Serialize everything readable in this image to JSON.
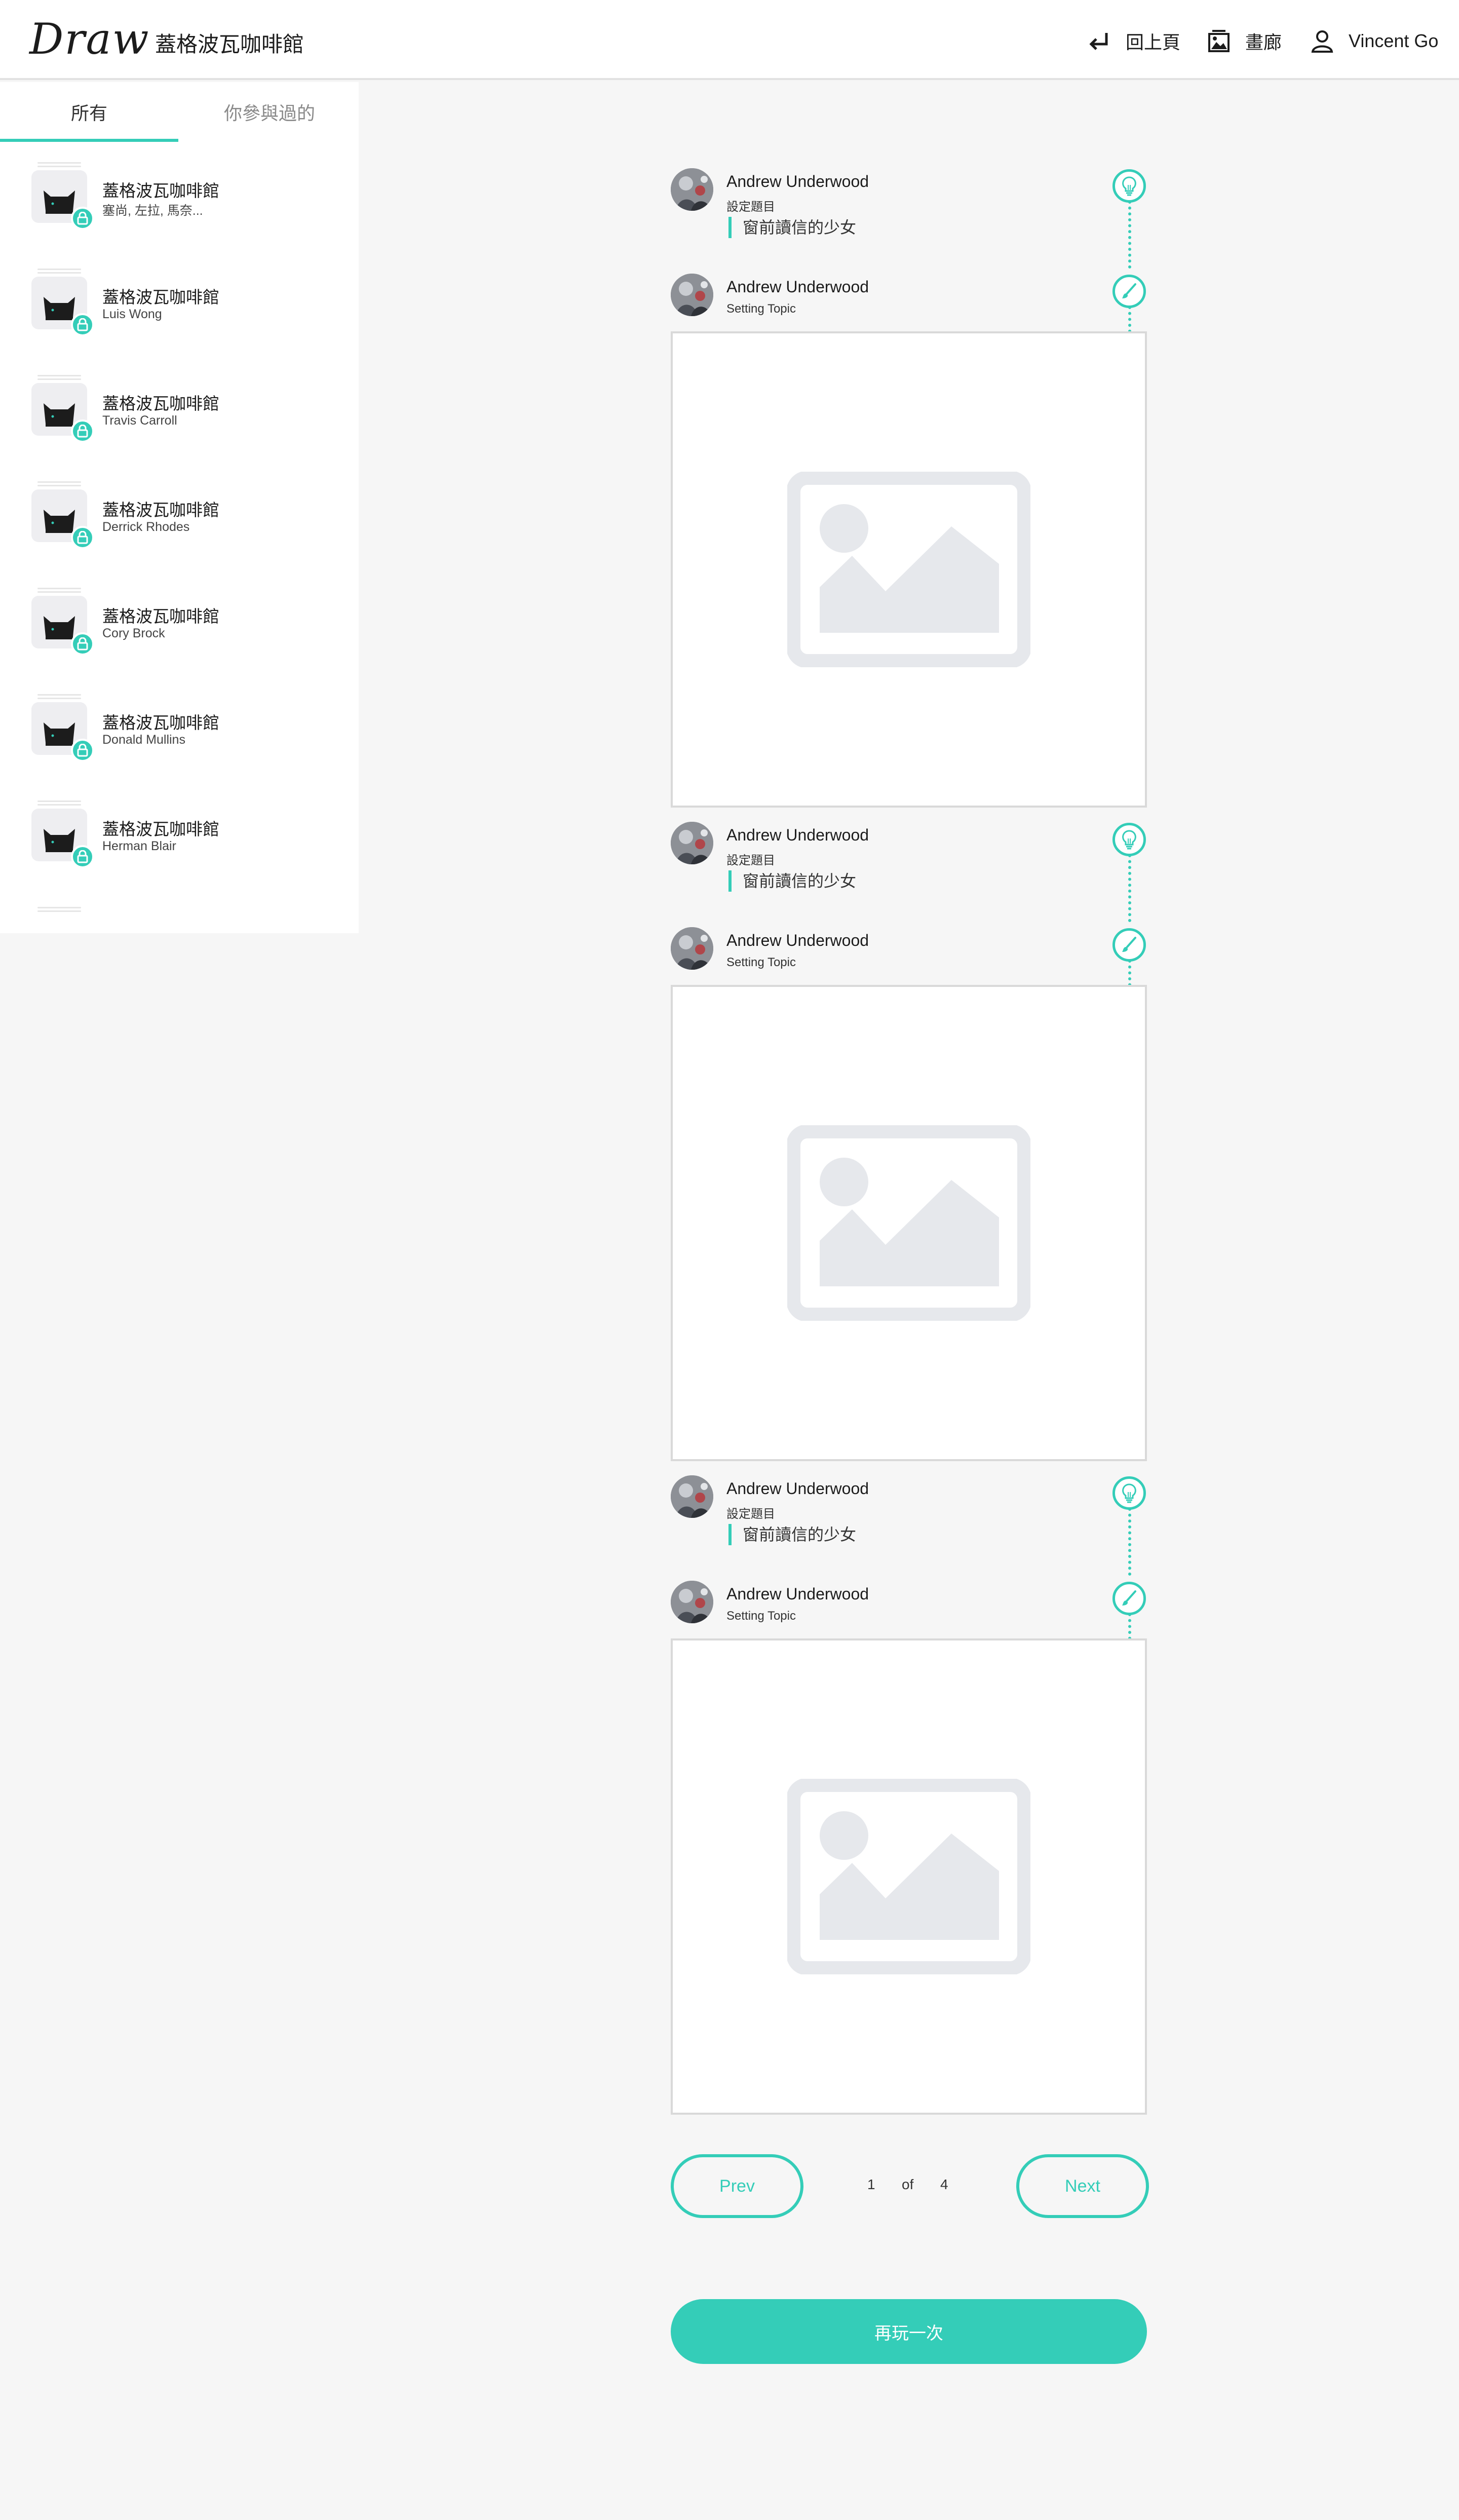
{
  "header": {
    "logo": "Draw",
    "title": "蓋格波瓦咖啡館",
    "nav": {
      "back_label": "回上頁",
      "gallery_label": "畫廊",
      "user_name": "Vincent Go"
    }
  },
  "sidebar": {
    "tabs": [
      {
        "label": "所有"
      },
      {
        "label": "你參與過的"
      }
    ],
    "active_tab": "所有",
    "rooms": [
      {
        "name": "蓋格波瓦咖啡館",
        "players": "塞尚, 左拉, 馬奈..."
      },
      {
        "name": "蓋格波瓦咖啡館",
        "players": "Luis Wong"
      },
      {
        "name": "蓋格波瓦咖啡館",
        "players": "Travis Carroll"
      },
      {
        "name": "蓋格波瓦咖啡館",
        "players": "Derrick Rhodes"
      },
      {
        "name": "蓋格波瓦咖啡館",
        "players": "Cory Brock"
      },
      {
        "name": "蓋格波瓦咖啡館",
        "players": "Donald Mullins"
      },
      {
        "name": "蓋格波瓦咖啡館",
        "players": "Herman Blair"
      }
    ]
  },
  "timeline": {
    "rounds": [
      {
        "topic": {
          "player": "Andrew Underwood",
          "label": "設定題目",
          "text": "窗前讀信的少女",
          "icon": "lightbulb-icon"
        },
        "drawing": {
          "player": "Andrew Underwood",
          "label": "Setting Topic",
          "icon": "brush-icon"
        }
      },
      {
        "topic": {
          "player": "Andrew Underwood",
          "label": "設定題目",
          "text": "窗前讀信的少女",
          "icon": "lightbulb-icon"
        },
        "drawing": {
          "player": "Andrew Underwood",
          "label": "Setting Topic",
          "icon": "brush-icon"
        }
      },
      {
        "topic": {
          "player": "Andrew Underwood",
          "label": "設定題目",
          "text": "窗前讀信的少女",
          "icon": "lightbulb-icon"
        },
        "drawing": {
          "player": "Andrew Underwood",
          "label": "Setting Topic",
          "icon": "brush-icon"
        }
      }
    ]
  },
  "pagination": {
    "prev_label": "Prev",
    "next_label": "Next",
    "current": "1",
    "of_label": "of",
    "total": "4"
  },
  "replay_label": "再玩一次",
  "colors": {
    "accent": "#34cdb8",
    "background": "#f6f6f6",
    "placeholder": "#e6e8ec"
  }
}
